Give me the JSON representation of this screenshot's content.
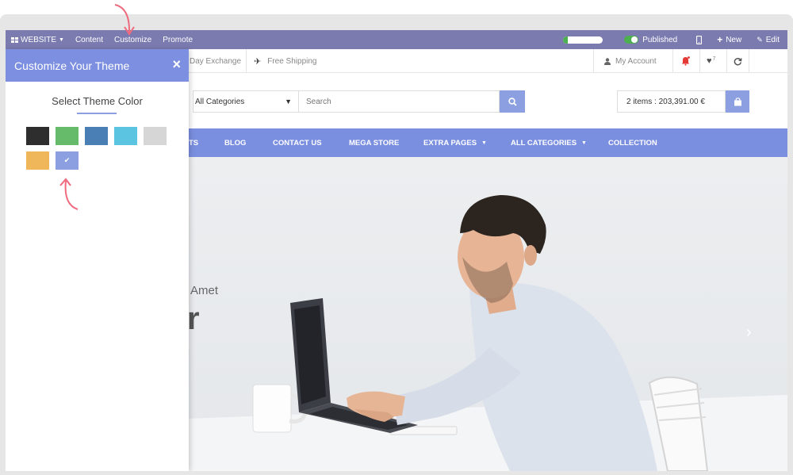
{
  "adminbar": {
    "website": "WEBSITE",
    "content": "Content",
    "customize": "Customize",
    "promote": "Promote",
    "progress": 0.12,
    "published": "Published",
    "new": "New",
    "edit": "Edit"
  },
  "topbar": {
    "exchange": "Day Exchange",
    "shipping": "Free Shipping",
    "account": "My Account",
    "wishlist_count": "7"
  },
  "header": {
    "category_select": "All Categories",
    "search_placeholder": "Search",
    "cart": "2 items : 203,391.00 €"
  },
  "nav": {
    "items": [
      "TS",
      "BLOG",
      "CONTACT US",
      "MEGA STORE",
      "EXTRA PAGES",
      "ALL CATEGORIES",
      "COLLECTION"
    ]
  },
  "hero": {
    "subtitle": "Amet",
    "title_fragment": "r"
  },
  "panel": {
    "title": "Customize Your Theme",
    "subtitle": "Select Theme Color",
    "swatches": [
      {
        "color": "#2e2e2e",
        "selected": false
      },
      {
        "color": "#66bb6a",
        "selected": false
      },
      {
        "color": "#4a7fb5",
        "selected": false
      },
      {
        "color": "#5bc4e0",
        "selected": false
      },
      {
        "color": "#d6d6d6",
        "selected": false
      },
      {
        "color": "#f0b65a",
        "selected": false
      },
      {
        "color": "#8c9fe0",
        "selected": true
      }
    ]
  },
  "colors": {
    "adminbar": "#7b7bb0",
    "accent": "#7d8fe0",
    "annotation": "#f06a7e"
  }
}
